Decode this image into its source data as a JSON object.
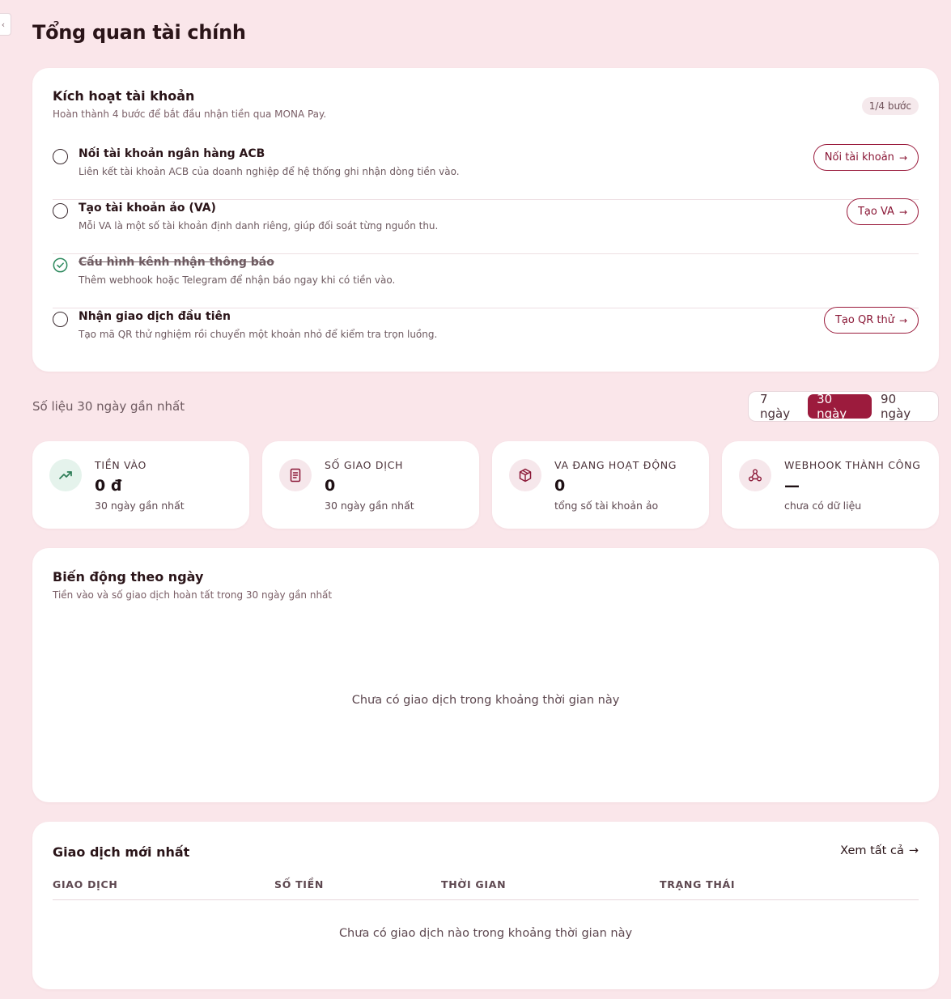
{
  "page": {
    "title": "Tổng quan tài chính",
    "collapse_glyph": "‹"
  },
  "activation": {
    "title": "Kích hoạt tài khoản",
    "subtitle": "Hoàn thành 4 bước để bắt đầu nhận tiền qua MONA Pay.",
    "badge": "1/4 bước",
    "steps": [
      {
        "title": "Nối tài khoản ngân hàng ACB",
        "desc": "Liên kết tài khoản ACB của doanh nghiệp để hệ thống ghi nhận dòng tiền vào.",
        "done": false,
        "button": "Nối tài khoản"
      },
      {
        "title": "Tạo tài khoản ảo (VA)",
        "desc": "Mỗi VA là một số tài khoản định danh riêng, giúp đối soát từng nguồn thu.",
        "done": false,
        "button": "Tạo VA"
      },
      {
        "title": "Cấu hình kênh nhận thông báo",
        "desc": "Thêm webhook hoặc Telegram để nhận báo ngay khi có tiền vào.",
        "done": true,
        "button": ""
      },
      {
        "title": "Nhận giao dịch đầu tiên",
        "desc": "Tạo mã QR thử nghiệm rồi chuyển một khoản nhỏ để kiểm tra trọn luồng.",
        "done": false,
        "button": "Tạo QR thử"
      }
    ]
  },
  "range": {
    "label": "Số liệu 30 ngày gần nhất",
    "options": [
      "7 ngày",
      "30 ngày",
      "90 ngày"
    ],
    "selected": "30 ngày"
  },
  "stats": [
    {
      "icon": "trending-up-icon",
      "label": "TIỀN VÀO",
      "value": "0 đ",
      "note": "30 ngày gần nhất"
    },
    {
      "icon": "receipt-icon",
      "label": "SỐ GIAO DỊCH",
      "value": "0",
      "note": "30 ngày gần nhất"
    },
    {
      "icon": "package-icon",
      "label": "VA ĐANG HOẠT ĐỘNG",
      "value": "0",
      "note": "tổng số tài khoản ảo"
    },
    {
      "icon": "webhook-icon",
      "label": "WEBHOOK THÀNH CÔNG",
      "value": "—",
      "note": "chưa có dữ liệu"
    }
  ],
  "chart": {
    "title": "Biến động theo ngày",
    "subtitle": "Tiền vào và số giao dịch hoàn tất trong 30 ngày gần nhất",
    "empty": "Chưa có giao dịch trong khoảng thời gian này"
  },
  "transactions": {
    "title": "Giao dịch mới nhất",
    "view_all": "Xem tất cả",
    "columns": [
      "GIAO DỊCH",
      "SỐ TIỀN",
      "THỜI GIAN",
      "TRẠNG THÁI"
    ],
    "empty": "Chưa có giao dịch nào trong khoảng thời gian này"
  },
  "colors": {
    "accent": "#9c1b3d",
    "background": "#fae6ea",
    "success": "#2e8a5e"
  }
}
